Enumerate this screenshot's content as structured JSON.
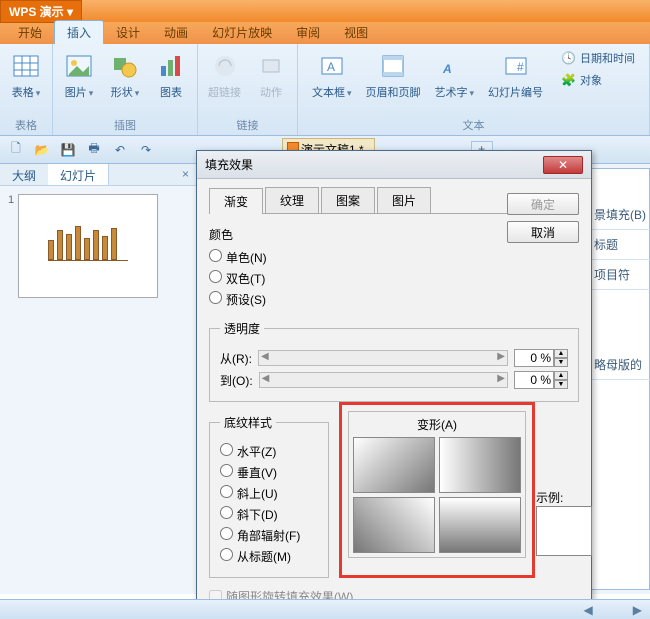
{
  "app": {
    "title": "WPS 演示"
  },
  "ribbonTabs": [
    "开始",
    "插入",
    "设计",
    "动画",
    "幻灯片放映",
    "审阅",
    "视图"
  ],
  "activeRibbonTab": 1,
  "ribbon": {
    "groups": [
      {
        "label": "表格",
        "items": [
          {
            "name": "表格"
          }
        ]
      },
      {
        "label": "插图",
        "items": [
          {
            "name": "图片"
          },
          {
            "name": "形状"
          },
          {
            "name": "图表"
          }
        ]
      },
      {
        "label": "链接",
        "items": [
          {
            "name": "超链接",
            "disabled": true
          },
          {
            "name": "动作",
            "disabled": true
          }
        ]
      },
      {
        "label": "文本",
        "items": [
          {
            "name": "文本框"
          },
          {
            "name": "页眉和页脚"
          },
          {
            "name": "艺术字"
          },
          {
            "name": "幻灯片编号"
          },
          {
            "name": "日期和时间"
          },
          {
            "name": "对象"
          }
        ]
      }
    ]
  },
  "docTab": "演示文稿1 *",
  "sideTabs": {
    "outline": "大纲",
    "slides": "幻灯片"
  },
  "slideNum": "1",
  "rightPane": {
    "fillBg": "景填充(B)",
    "title": "标题",
    "bullet": "项目符",
    "omitMaster": "略母版的"
  },
  "dialog": {
    "title": "填充效果",
    "tabs": [
      "渐变",
      "纹理",
      "图案",
      "图片"
    ],
    "ok": "确定",
    "cancel": "取消",
    "color": {
      "label": "颜色",
      "one": "单色(N)",
      "two": "双色(T)",
      "preset": "预设(S)"
    },
    "transparency": {
      "label": "透明度",
      "from": "从(R):",
      "to": "到(O):",
      "fromVal": "0 %",
      "toVal": "0 %"
    },
    "shading": {
      "label": "底纹样式",
      "h": "水平(Z)",
      "v": "垂直(V)",
      "du": "斜上(U)",
      "dd": "斜下(D)",
      "corner": "角部辐射(F)",
      "title": "从标题(M)"
    },
    "variant": "变形(A)",
    "sample": "示例:",
    "rotate": "随图形旋转填充效果(W)"
  }
}
